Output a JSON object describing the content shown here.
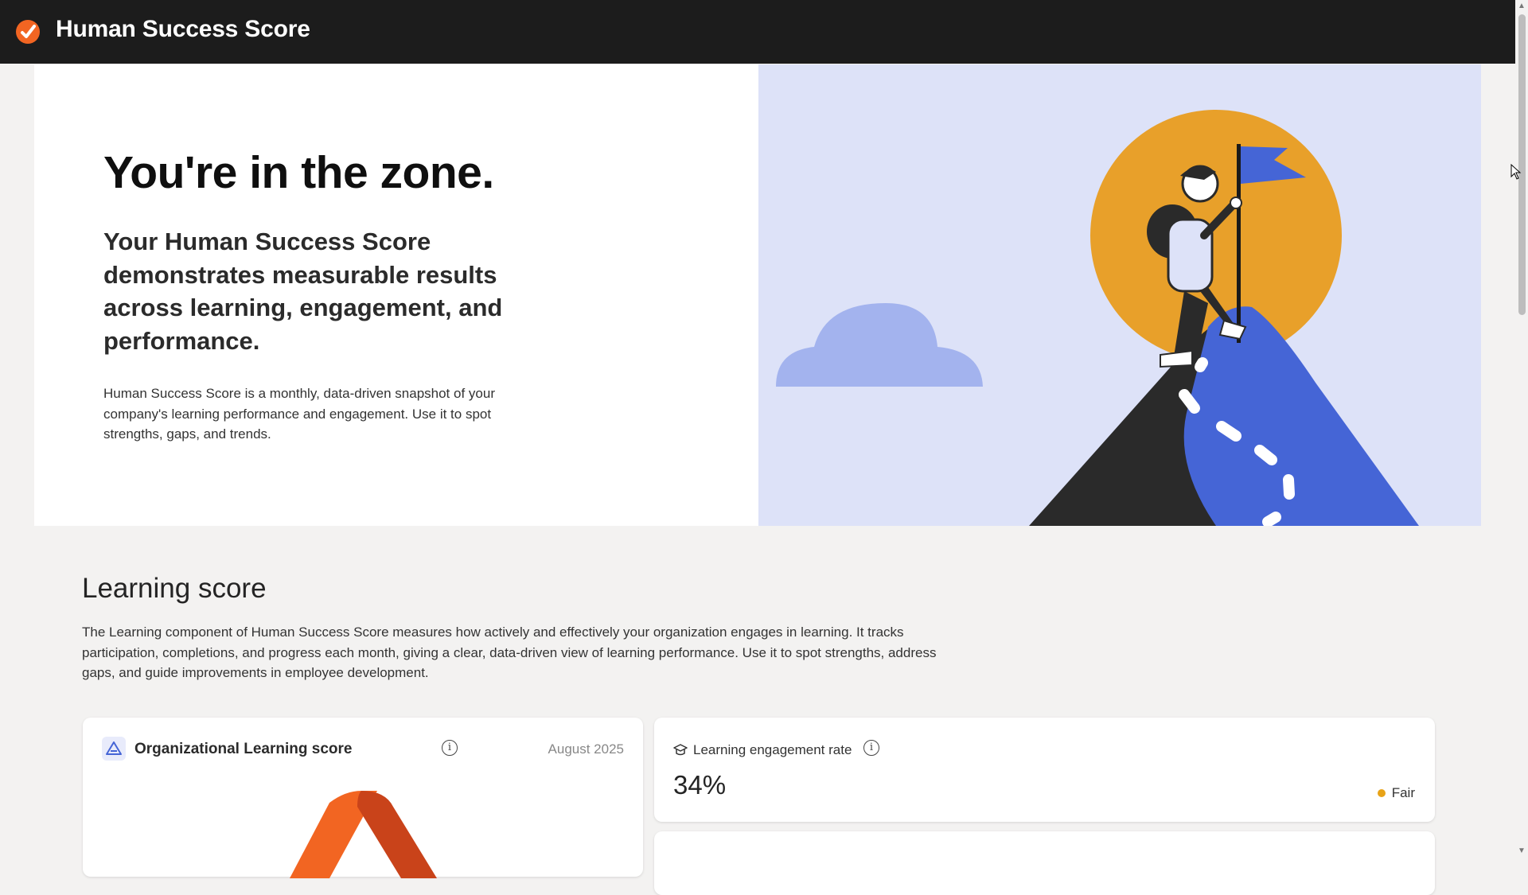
{
  "app": {
    "title": "Human Success Score"
  },
  "hero": {
    "heading": "You're in the zone.",
    "subheading": "Your Human Success Score demonstrates measurable results across learning, engagement, and performance.",
    "description": "Human Success Score is a monthly, data-driven snapshot of your company's learning performance and engagement. Use it to spot strengths, gaps, and trends.",
    "illustration": "person-planting-flag-on-mountain"
  },
  "learning_section": {
    "title": "Learning score",
    "description": "The Learning component of Human Success Score measures how actively and effectively your organization engages in learning. It tracks participation, completions, and progress each month, giving a clear, data-driven view of learning performance. Use it to spot strengths, address gaps, and guide improvements in employee development."
  },
  "cards": {
    "org_learning": {
      "title": "Organizational Learning score",
      "date": "August 2025",
      "icon": "triangle-logo-icon",
      "info_icon": "info-icon"
    },
    "engagement_rate": {
      "title": "Learning engagement rate",
      "value": "34%",
      "status": "Fair",
      "icon": "graduation-cap-icon",
      "info_icon": "info-icon"
    }
  },
  "colors": {
    "topbar": "#1c1c1c",
    "brand_orange": "#f26522",
    "hero_art_bg": "#dde2f8",
    "sun": "#e8a02a",
    "mountain_blue": "#4565d6",
    "status_fair": "#e8a317"
  }
}
